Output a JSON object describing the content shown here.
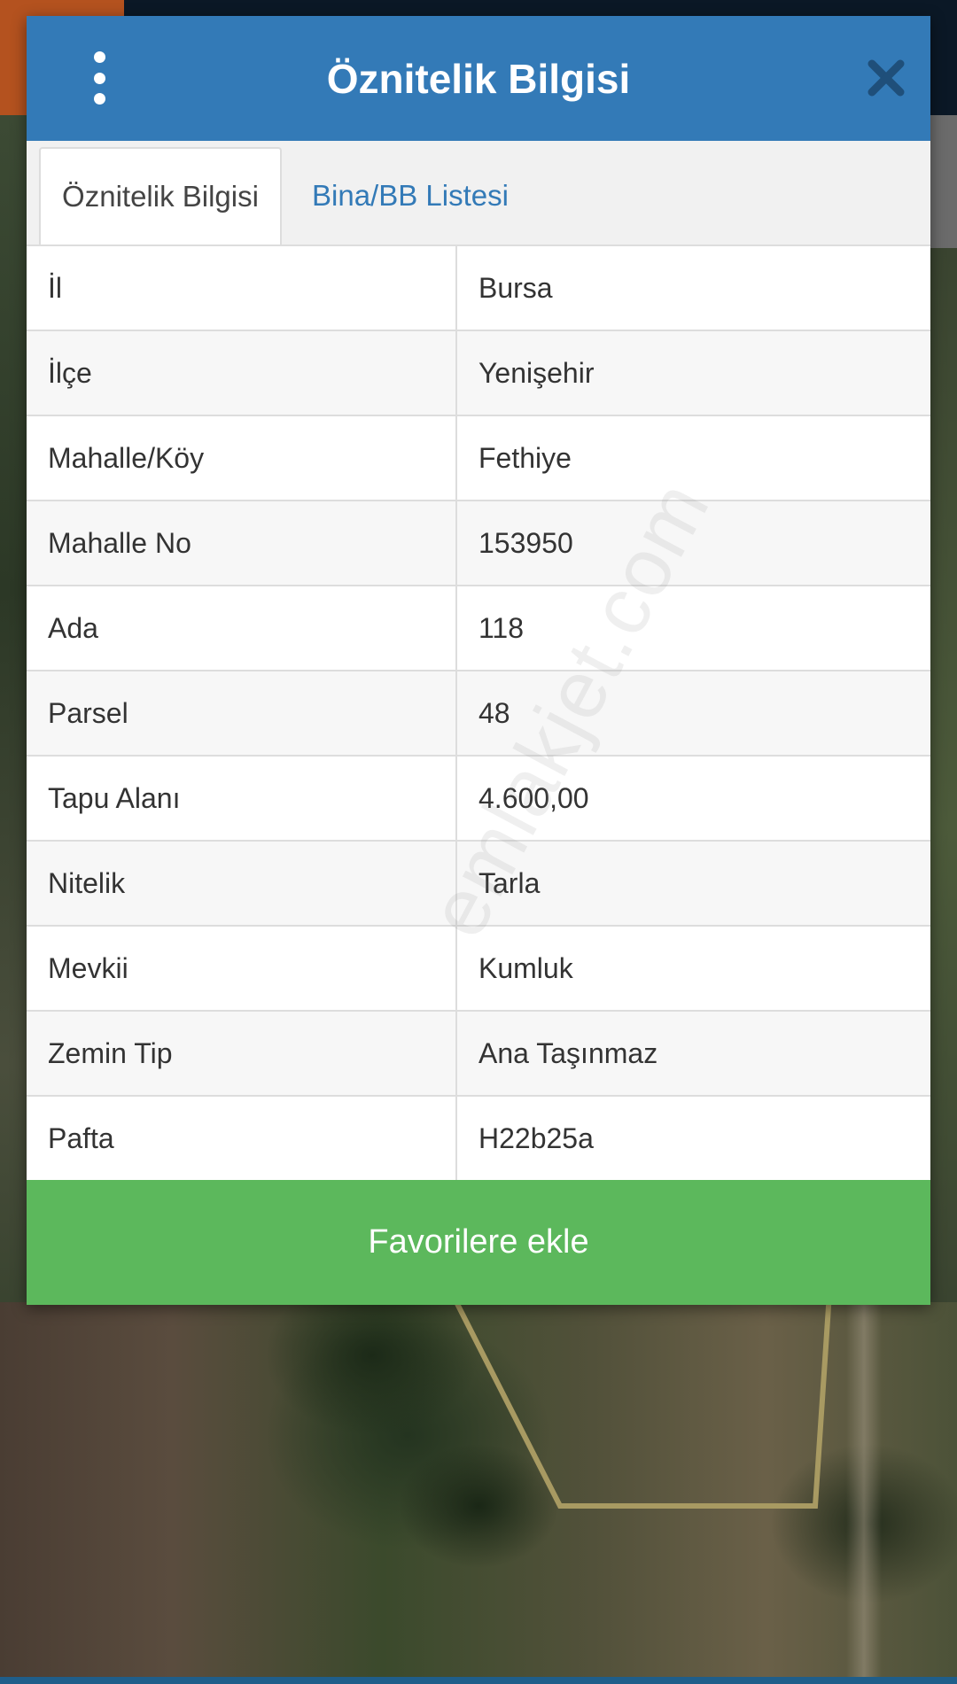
{
  "dialog": {
    "title": "Öznitelik Bilgisi",
    "menu_icon": "vertical-dots-icon",
    "close_icon": "close-icon"
  },
  "tabs": [
    {
      "label": "Öznitelik Bilgisi",
      "active": true
    },
    {
      "label": "Bina/BB Listesi",
      "active": false
    }
  ],
  "attributes": [
    {
      "key": "İl",
      "value": "Bursa"
    },
    {
      "key": "İlçe",
      "value": "Yenişehir"
    },
    {
      "key": "Mahalle/Köy",
      "value": "Fethiye"
    },
    {
      "key": "Mahalle No",
      "value": "153950"
    },
    {
      "key": "Ada",
      "value": "118"
    },
    {
      "key": "Parsel",
      "value": "48"
    },
    {
      "key": "Tapu Alanı",
      "value": "4.600,00"
    },
    {
      "key": "Nitelik",
      "value": "Tarla"
    },
    {
      "key": "Mevkii",
      "value": "Kumluk"
    },
    {
      "key": "Zemin Tip",
      "value": "Ana Taşınmaz"
    },
    {
      "key": "Pafta",
      "value": "H22b25a"
    }
  ],
  "favorite_button": {
    "label": "Favorilere ekle"
  },
  "watermark": "emlakjet.com",
  "colors": {
    "header": "#337ab7",
    "tab_link": "#337ab7",
    "button": "#5cb85c",
    "parcel_outline": "#a89a62"
  }
}
